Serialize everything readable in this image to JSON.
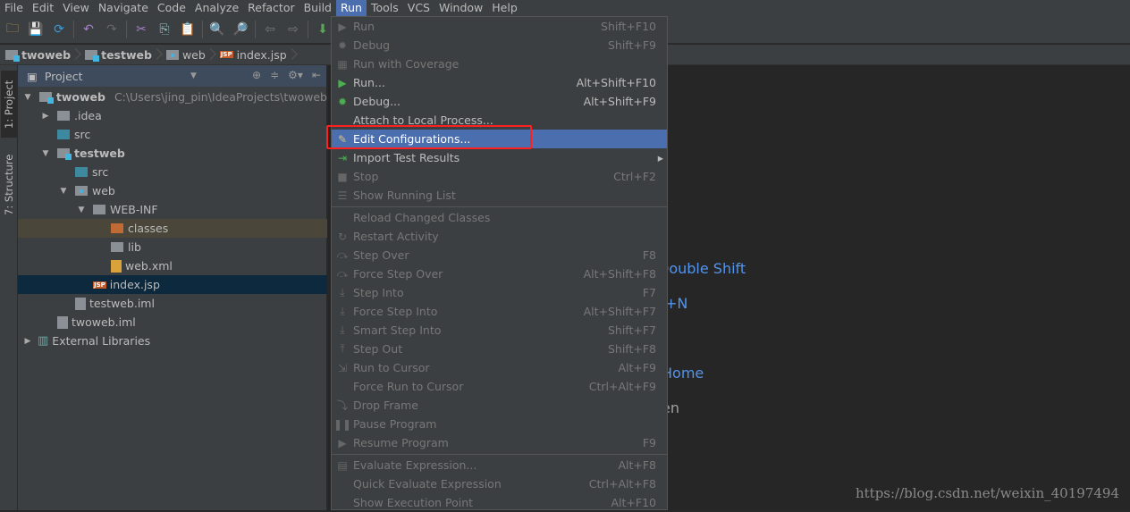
{
  "menubar": [
    "File",
    "Edit",
    "View",
    "Navigate",
    "Code",
    "Analyze",
    "Refactor",
    "Build",
    "Run",
    "Tools",
    "VCS",
    "Window",
    "Help"
  ],
  "active_menu": "Run",
  "toolbar_icons": [
    "open-folder-icon",
    "save-icon",
    "sync-icon",
    "undo-icon",
    "redo-icon",
    "cut-icon",
    "copy-icon",
    "paste-icon",
    "find-icon",
    "replace-icon",
    "back-icon",
    "forward-icon",
    "build-icon"
  ],
  "breadcrumb": [
    {
      "label": "twoweb",
      "icon": "module"
    },
    {
      "label": "testweb",
      "icon": "module"
    },
    {
      "label": "web",
      "icon": "web"
    },
    {
      "label": "index.jsp",
      "icon": "jsp"
    }
  ],
  "left_tabs": [
    "1: Project",
    "7: Structure"
  ],
  "project": {
    "title": "Project",
    "tree": [
      {
        "label": "twoweb",
        "path": "C:\\Users\\jing_pin\\IdeaProjects\\twoweb",
        "depth": 0,
        "arrow": "down",
        "icon": "mod",
        "bold": true
      },
      {
        "label": ".idea",
        "depth": 1,
        "arrow": "right",
        "icon": "plain"
      },
      {
        "label": "src",
        "depth": 1,
        "icon": "src"
      },
      {
        "label": "testweb",
        "depth": 1,
        "arrow": "down",
        "icon": "mod",
        "bold": true
      },
      {
        "label": "src",
        "depth": 2,
        "icon": "src"
      },
      {
        "label": "web",
        "depth": 2,
        "arrow": "down",
        "icon": "web"
      },
      {
        "label": "WEB-INF",
        "depth": 3,
        "arrow": "down",
        "icon": "plain"
      },
      {
        "label": "classes",
        "depth": 4,
        "icon": "cls",
        "state": "hl"
      },
      {
        "label": "lib",
        "depth": 4,
        "icon": "plain"
      },
      {
        "label": "web.xml",
        "depth": 4,
        "icon": "xml"
      },
      {
        "label": "index.jsp",
        "depth": 3,
        "icon": "jsp",
        "state": "sel"
      },
      {
        "label": "testweb.iml",
        "depth": 2,
        "icon": "file"
      },
      {
        "label": "twoweb.iml",
        "depth": 1,
        "icon": "file"
      },
      {
        "label": "External Libraries",
        "depth": 0,
        "arrow": "right",
        "icon": "lib"
      }
    ]
  },
  "run_menu": [
    {
      "label": "Run",
      "shortcut": "Shift+F10",
      "enabled": false,
      "icon": "run-icon"
    },
    {
      "label": "Debug",
      "shortcut": "Shift+F9",
      "enabled": false,
      "icon": "debug-icon"
    },
    {
      "label": "Run with Coverage",
      "shortcut": "",
      "enabled": false,
      "icon": "coverage-icon"
    },
    {
      "label": "Run...",
      "shortcut": "Alt+Shift+F10",
      "enabled": true,
      "icon": "run-icon"
    },
    {
      "label": "Debug...",
      "shortcut": "Alt+Shift+F9",
      "enabled": true,
      "icon": "debug-icon"
    },
    {
      "label": "Attach to Local Process...",
      "shortcut": "",
      "enabled": true,
      "icon": ""
    },
    {
      "label": "Edit Configurations...",
      "shortcut": "",
      "enabled": true,
      "icon": "edit-config-icon",
      "selected": true
    },
    {
      "label": "Import Test Results",
      "shortcut": "",
      "enabled": true,
      "icon": "import-icon",
      "submenu": true
    },
    {
      "label": "Stop",
      "shortcut": "Ctrl+F2",
      "enabled": false,
      "icon": "stop-icon"
    },
    {
      "label": "Show Running List",
      "shortcut": "",
      "enabled": false,
      "icon": "list-icon",
      "sep_after": true
    },
    {
      "label": "Reload Changed Classes",
      "shortcut": "",
      "enabled": false,
      "icon": ""
    },
    {
      "label": "Restart Activity",
      "shortcut": "",
      "enabled": false,
      "icon": "restart-icon"
    },
    {
      "label": "Step Over",
      "shortcut": "F8",
      "enabled": false,
      "icon": "step-over-icon"
    },
    {
      "label": "Force Step Over",
      "shortcut": "Alt+Shift+F8",
      "enabled": false,
      "icon": "step-over-icon"
    },
    {
      "label": "Step Into",
      "shortcut": "F7",
      "enabled": false,
      "icon": "step-into-icon"
    },
    {
      "label": "Force Step Into",
      "shortcut": "Alt+Shift+F7",
      "enabled": false,
      "icon": "step-into-icon"
    },
    {
      "label": "Smart Step Into",
      "shortcut": "Shift+F7",
      "enabled": false,
      "icon": "step-into-icon"
    },
    {
      "label": "Step Out",
      "shortcut": "Shift+F8",
      "enabled": false,
      "icon": "step-out-icon"
    },
    {
      "label": "Run to Cursor",
      "shortcut": "Alt+F9",
      "enabled": false,
      "icon": "cursor-icon"
    },
    {
      "label": "Force Run to Cursor",
      "shortcut": "Ctrl+Alt+F9",
      "enabled": false,
      "icon": ""
    },
    {
      "label": "Drop Frame",
      "shortcut": "",
      "enabled": false,
      "icon": "drop-frame-icon"
    },
    {
      "label": "Pause Program",
      "shortcut": "",
      "enabled": false,
      "icon": "pause-icon"
    },
    {
      "label": "Resume Program",
      "shortcut": "F9",
      "enabled": false,
      "icon": "resume-icon",
      "sep_after": true
    },
    {
      "label": "Evaluate Expression...",
      "shortcut": "Alt+F8",
      "enabled": false,
      "icon": "evaluate-icon"
    },
    {
      "label": "Quick Evaluate Expression",
      "shortcut": "Ctrl+Alt+F8",
      "enabled": false,
      "icon": ""
    },
    {
      "label": "Show Execution Point",
      "shortcut": "Alt+F10",
      "enabled": false,
      "icon": ""
    }
  ],
  "editor_hints": [
    "Double Shift",
    "+N",
    "Home",
    "en"
  ],
  "watermark": "https://blog.csdn.net/weixin_40197494",
  "colors": {
    "menu_selection": "#4b6eaf",
    "highlight_box": "#ff2020",
    "hint_link": "#5394ec"
  }
}
